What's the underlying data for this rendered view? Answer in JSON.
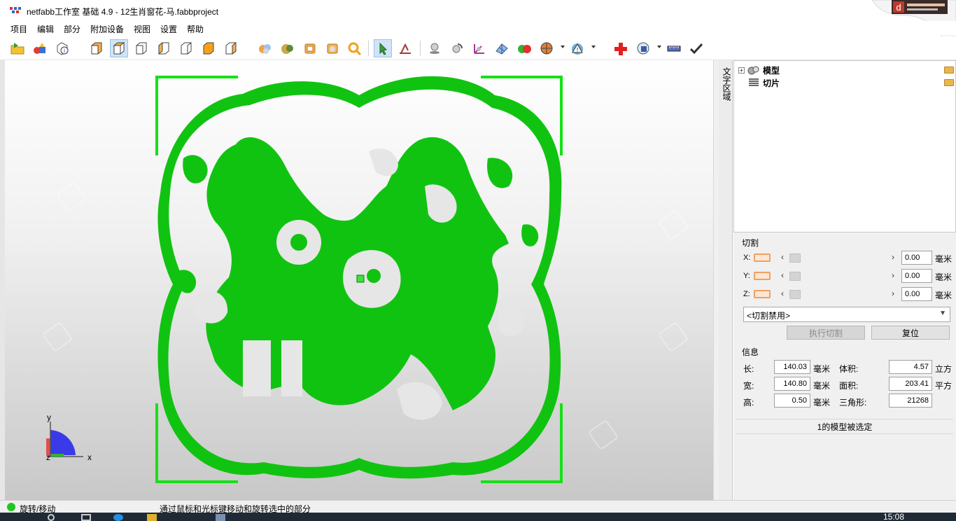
{
  "window": {
    "title": "netfabb工作室 基础 4.9 - 12生肖窗花-马.fabbproject",
    "corner_logo_text": "d"
  },
  "menu": [
    "项目",
    "编辑",
    "部分",
    "附加设备",
    "视图",
    "设置",
    "帮助"
  ],
  "toolbar": {
    "buttons": [
      "open-project-icon",
      "add-part-icon",
      "part-info-icon",
      "view-front-icon",
      "view-top-icon",
      "view-back-icon",
      "view-left-icon",
      "view-right-icon",
      "view-bottom-icon",
      "view-perspective-icon",
      "shade-icon",
      "shade-texture-icon",
      "wireframe-icon",
      "transparent-icon",
      "zoom-icon",
      "select-cursor-icon",
      "measure-icon",
      "move-icon",
      "rotate-icon",
      "scale-icon",
      "mesh-icon",
      "color-icon",
      "sphere-icon",
      "warning-icon",
      "repair-cross-icon",
      "analysis-icon",
      "ruler-icon",
      "check-icon"
    ],
    "active_button": "select-cursor-icon"
  },
  "viewport": {
    "model_color": "#11c311",
    "bracket_color": "#17e017",
    "axis_labels": {
      "y": "y",
      "x": "x",
      "z": "z"
    }
  },
  "side_tab": {
    "label": "文字区域"
  },
  "tree": {
    "items": [
      {
        "label": "模型",
        "icon": "models-icon",
        "expander": "+"
      },
      {
        "label": "切片",
        "icon": "slices-icon",
        "expander": ""
      }
    ]
  },
  "cut": {
    "title": "切割",
    "axes": [
      {
        "label": "X:",
        "value": "0.00",
        "unit": "毫米"
      },
      {
        "label": "Y:",
        "value": "0.00",
        "unit": "毫米"
      },
      {
        "label": "Z:",
        "value": "0.00",
        "unit": "毫米"
      }
    ],
    "mode_selected": "<切割禁用>",
    "execute_label": "执行切割",
    "reset_label": "复位"
  },
  "info": {
    "title": "信息",
    "length_label": "长:",
    "length_value": "140.03",
    "length_unit": "毫米",
    "width_label": "宽:",
    "width_value": "140.80",
    "width_unit": "毫米",
    "height_label": "高:",
    "height_value": "0.50",
    "height_unit": "毫米",
    "volume_label": "体积:",
    "volume_value": "4.57",
    "volume_unit": "立方",
    "area_label": "面积:",
    "area_value": "203.41",
    "area_unit": "平方",
    "triangles_label": "三角形:",
    "triangles_value": "21268",
    "selection_status": "1的模型被选定"
  },
  "statusbar": {
    "mode": "旋转/移动",
    "hint": "通过鼠标和光标键移动和旋转选中的部分"
  },
  "taskbar": {
    "clock": "15:08"
  }
}
